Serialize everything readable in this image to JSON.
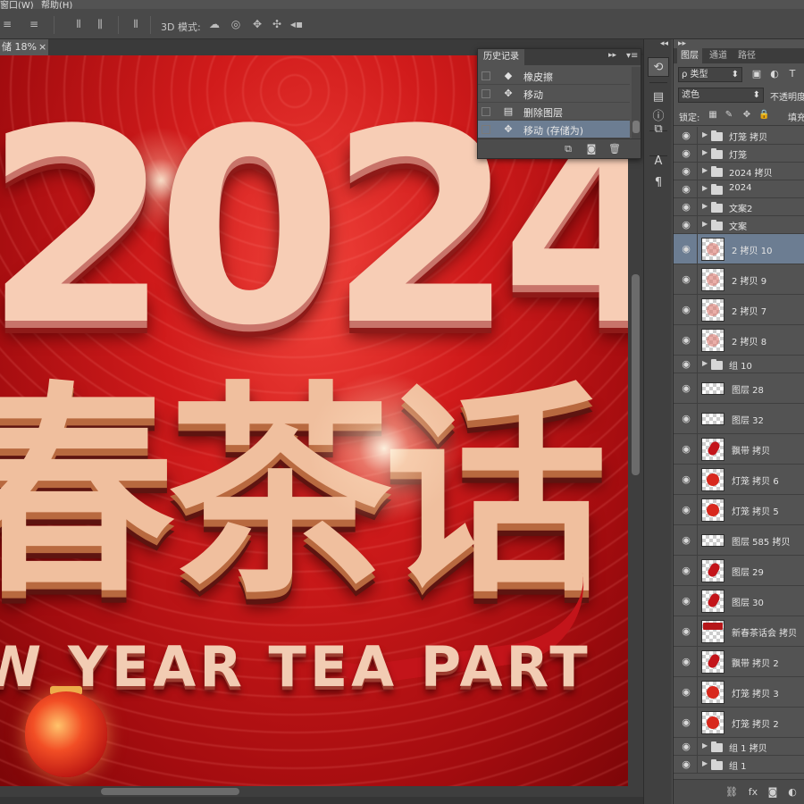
{
  "menu": {
    "items": [
      "窗口(W)",
      "帮助(H)"
    ]
  },
  "options_bar": {
    "mode_3d_label": "3D 模式:",
    "icons": [
      "align-left-icon",
      "align-center-icon",
      "distribute-icon",
      "distribute-columns-icon",
      "orbit-icon",
      "roll-icon",
      "pan-icon",
      "slide-icon",
      "video-icon"
    ]
  },
  "document": {
    "tab_label": "储 18%",
    "close_glyph": "×",
    "artwork": {
      "year": "2024",
      "title": "春茶话",
      "subtitle": "W YEAR TEA PART"
    }
  },
  "history_panel": {
    "title": "历史记录",
    "items": [
      {
        "icon": "eraser-icon",
        "label": "橡皮擦",
        "selected": false
      },
      {
        "icon": "move-icon",
        "label": "移动",
        "selected": false
      },
      {
        "icon": "delete-layer-icon",
        "label": "删除图层",
        "selected": false
      },
      {
        "icon": "move-icon",
        "label": "移动 (存储为)",
        "selected": true
      }
    ]
  },
  "layers_panel": {
    "tabs": [
      "图层",
      "通道",
      "路径"
    ],
    "filter_label": "ρ 类型",
    "blend_mode": "滤色",
    "opacity_label": "不透明度",
    "lock_label": "锁定:",
    "fill_label": "填充",
    "layers": [
      {
        "name": "灯笼 拷贝",
        "kind": "group"
      },
      {
        "name": "灯笼",
        "kind": "group"
      },
      {
        "name": "2024 拷贝",
        "kind": "group"
      },
      {
        "name": "2024",
        "kind": "group"
      },
      {
        "name": "文案2",
        "kind": "group"
      },
      {
        "name": "文案",
        "kind": "group"
      },
      {
        "name": "2 拷贝 10",
        "kind": "layer",
        "thumb": "pink",
        "selected": true
      },
      {
        "name": "2 拷贝 9",
        "kind": "layer",
        "thumb": "pink"
      },
      {
        "name": "2 拷贝 7",
        "kind": "layer",
        "thumb": "pink"
      },
      {
        "name": "2 拷贝 8",
        "kind": "layer",
        "thumb": "pink"
      },
      {
        "name": "组 10",
        "kind": "group"
      },
      {
        "name": "图层 28",
        "kind": "layer",
        "thumb": "wide"
      },
      {
        "name": "图层 32",
        "kind": "layer",
        "thumb": "wide"
      },
      {
        "name": "飘带 拷贝",
        "kind": "layer",
        "thumb": "ribbon"
      },
      {
        "name": "灯笼 拷贝 6",
        "kind": "layer",
        "thumb": "lantern"
      },
      {
        "name": "灯笼 拷贝 5",
        "kind": "layer",
        "thumb": "lantern"
      },
      {
        "name": "图层 585 拷贝",
        "kind": "layer",
        "thumb": "wide"
      },
      {
        "name": "图层 29",
        "kind": "layer",
        "thumb": "ribbon"
      },
      {
        "name": "图层 30",
        "kind": "layer",
        "thumb": "ribbon"
      },
      {
        "name": "新春茶话会 拷贝",
        "kind": "layer",
        "thumb": "bar"
      },
      {
        "name": "飘带 拷贝 2",
        "kind": "layer",
        "thumb": "ribbon"
      },
      {
        "name": "灯笼 拷贝 3",
        "kind": "layer",
        "thumb": "lantern"
      },
      {
        "name": "灯笼 拷贝 2",
        "kind": "layer",
        "thumb": "lantern"
      },
      {
        "name": "组 1 拷贝",
        "kind": "group"
      },
      {
        "name": "组 1",
        "kind": "group"
      }
    ]
  },
  "colors": {
    "selection": "#6c7d92",
    "panel": "#535353",
    "canvas_red": "#d11b1b"
  }
}
